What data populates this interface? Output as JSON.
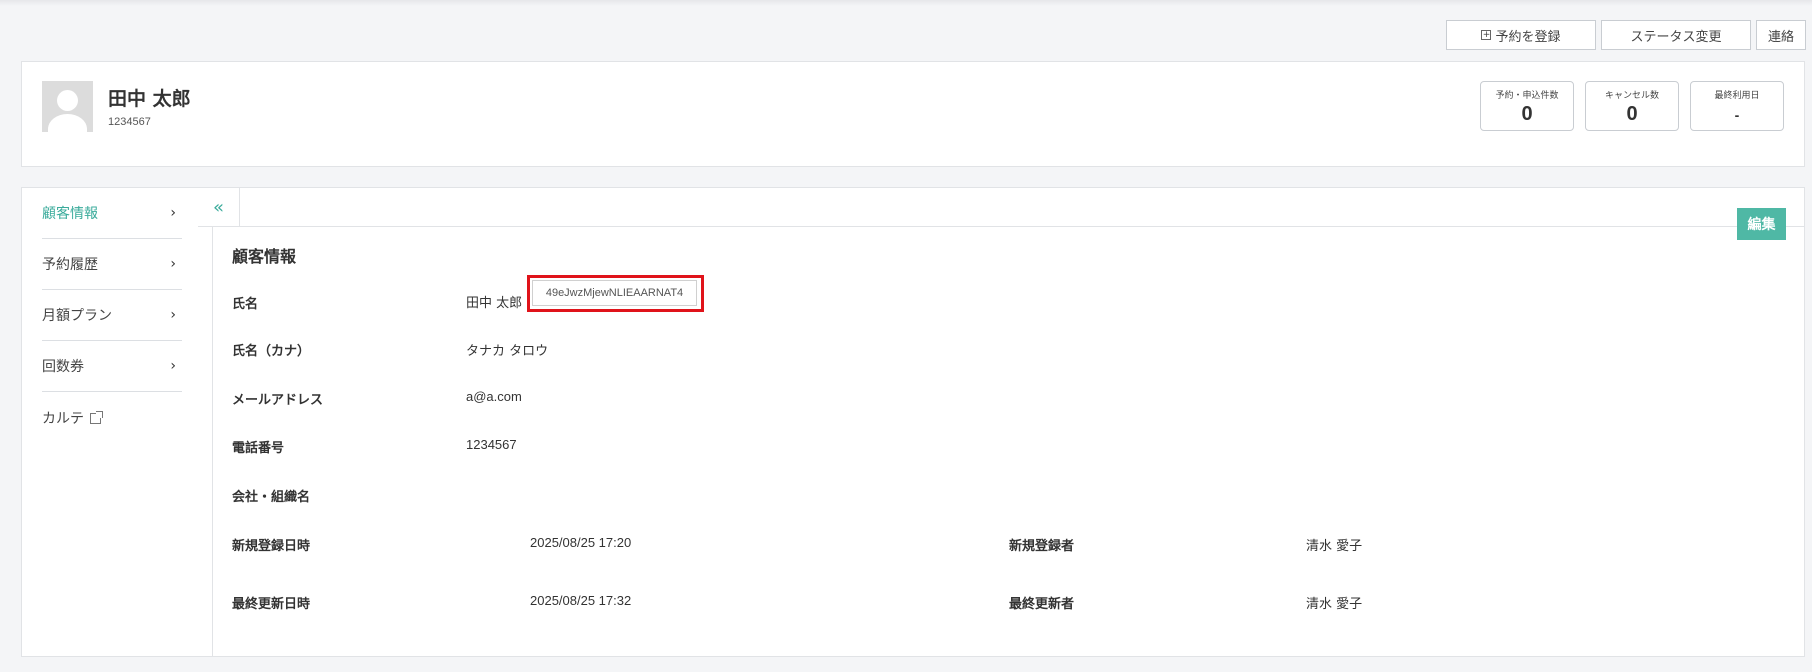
{
  "actions": {
    "reserve_label": "予約を登録",
    "status_label": "ステータス変更",
    "contact_label": "連絡"
  },
  "profile": {
    "name": "田中 太郎",
    "id": "1234567",
    "stats": [
      {
        "label": "予約・申込件数",
        "value": "0"
      },
      {
        "label": "キャンセル数",
        "value": "0"
      },
      {
        "label": "最終利用日",
        "value": "-"
      }
    ]
  },
  "sidebar": {
    "items": [
      {
        "label": "顧客情報"
      },
      {
        "label": "予約履歴"
      },
      {
        "label": "月額プラン"
      },
      {
        "label": "回数券"
      },
      {
        "label": "カルテ"
      }
    ]
  },
  "content": {
    "edit_label": "編集",
    "section_title": "顧客情報",
    "fields": [
      {
        "label": "氏名",
        "value": "田中 太郎"
      },
      {
        "label": "氏名（カナ）",
        "value": "タナカ タロウ"
      },
      {
        "label": "メールアドレス",
        "value": "a@a.com"
      },
      {
        "label": "電話番号",
        "value": "1234567"
      },
      {
        "label": "会社・組織名",
        "value": ""
      }
    ],
    "id_chip": "49eJwzMjewNLIEAARNAT4",
    "meta": {
      "created_at_label": "新規登録日時",
      "created_at": "2025/08/25 17:20",
      "created_by_label": "新規登録者",
      "created_by": "清水 愛子",
      "updated_at_label": "最終更新日時",
      "updated_at": "2025/08/25 17:32",
      "updated_by_label": "最終更新者",
      "updated_by": "清水 愛子"
    }
  },
  "colors": {
    "accent": "#3aab9b",
    "edit_button": "#4fb8a5",
    "highlight": "#e0131a"
  }
}
